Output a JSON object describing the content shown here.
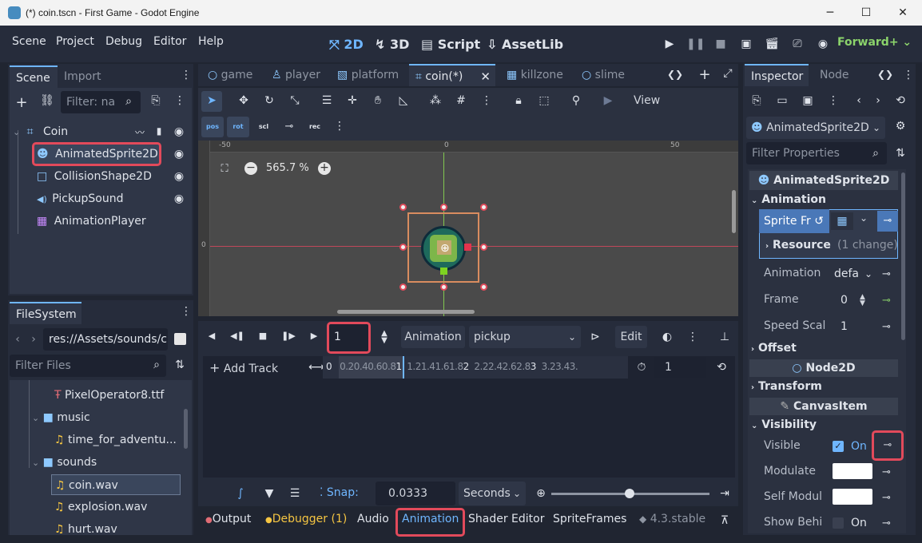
{
  "window": {
    "title": "(*) coin.tscn - First Game - Godot Engine",
    "minimize": "─",
    "maximize": "☐",
    "close": "✕"
  },
  "menu": [
    "Scene",
    "Project",
    "Debug",
    "Editor",
    "Help"
  ],
  "modes": [
    {
      "label": "2D",
      "icon": "⤧"
    },
    {
      "label": "3D",
      "icon": "↯"
    },
    {
      "label": "Script",
      "icon": "▤"
    },
    {
      "label": "AssetLib",
      "icon": "⇩"
    }
  ],
  "renderer": "Forward+",
  "scene_panel": {
    "tabs": [
      "Scene",
      "Import"
    ],
    "filter_placeholder": "Filter: na",
    "tree": [
      {
        "label": "Coin",
        "icon": "⌗",
        "depth": 0
      },
      {
        "label": "AnimatedSprite2D",
        "icon": "☻",
        "depth": 1
      },
      {
        "label": "CollisionShape2D",
        "icon": "□",
        "depth": 1
      },
      {
        "label": "PickupSound",
        "icon": "◀)",
        "depth": 1
      },
      {
        "label": "AnimationPlayer",
        "icon": "▦",
        "depth": 1
      }
    ]
  },
  "filesystem": {
    "tab": "FileSystem",
    "path": "res://Assets/sounds/c",
    "filter_placeholder": "Filter Files",
    "items": [
      {
        "label": "PixelOperator8.ttf",
        "type": "font"
      },
      {
        "label": "music",
        "type": "folder"
      },
      {
        "label": "time_for_adventu...",
        "type": "audio"
      },
      {
        "label": "sounds",
        "type": "folder"
      },
      {
        "label": "coin.wav",
        "type": "audio"
      },
      {
        "label": "explosion.wav",
        "type": "audio"
      },
      {
        "label": "hurt.wav",
        "type": "audio"
      }
    ]
  },
  "editor_tabs": [
    {
      "label": "game",
      "icon": "○"
    },
    {
      "label": "player",
      "icon": "♙"
    },
    {
      "label": "platform",
      "icon": "▧"
    },
    {
      "label": "coin(*)",
      "icon": "⌗"
    },
    {
      "label": "killzone",
      "icon": "▦"
    },
    {
      "label": "slime",
      "icon": "○"
    }
  ],
  "toolbar": {
    "view": "View",
    "anim_buttons": [
      "pos",
      "rot",
      "scl",
      "⊸",
      "rec"
    ]
  },
  "viewport": {
    "zoom": "565.7 %",
    "ruler": [
      "-50",
      "0",
      "50"
    ],
    "ruler_v": "0"
  },
  "animation": {
    "frame_value": "1",
    "animation_label": "Animation",
    "animation_name": "pickup",
    "edit_label": "Edit",
    "add_track": "Add Track",
    "timeline_labels": [
      "0",
      "0.2",
      "0.4",
      "0.6",
      "0.8",
      "1",
      "1.2",
      "1.4",
      "1.6",
      "1.8",
      "2",
      "2.2",
      "2.4",
      "2.6",
      "2.8",
      "3",
      "3.2",
      "3.4",
      "3."
    ],
    "length": "1",
    "snap_label": "Snap:",
    "snap_value": "0.0333",
    "snap_unit": "Seconds"
  },
  "bottom_tabs": [
    "Output",
    "Debugger (1)",
    "Audio",
    "Animation",
    "Shader Editor",
    "SpriteFrames"
  ],
  "version": "4.3.stable",
  "inspector": {
    "tabs": [
      "Inspector",
      "Node"
    ],
    "node_type": "AnimatedSprite2D",
    "filter_placeholder": "Filter Properties",
    "class_header": "AnimatedSprite2D",
    "sections": {
      "animation": "Animation",
      "offset": "Offset",
      "node2d": "Node2D",
      "transform": "Transform",
      "canvasitem": "CanvasItem",
      "visibility": "Visibility"
    },
    "props": {
      "sprite_frames": "Sprite Fr",
      "resource": "Resource",
      "resource_change": "(1 change)",
      "animation": "Animation",
      "animation_value": "defa",
      "frame": "Frame",
      "frame_value": "0",
      "speed": "Speed Scal",
      "speed_value": "1",
      "visible": "Visible",
      "visible_value": "On",
      "modulate": "Modulate",
      "self_modulate": "Self Modul",
      "show_behind": "Show Behi",
      "show_behind_value": "On"
    }
  },
  "colors": {
    "accent": "#6fb6ff",
    "highlight": "#e24a5b",
    "renderer": "#8bd36b",
    "debugger": "#f5c542",
    "output_dot": "#e06c75"
  }
}
